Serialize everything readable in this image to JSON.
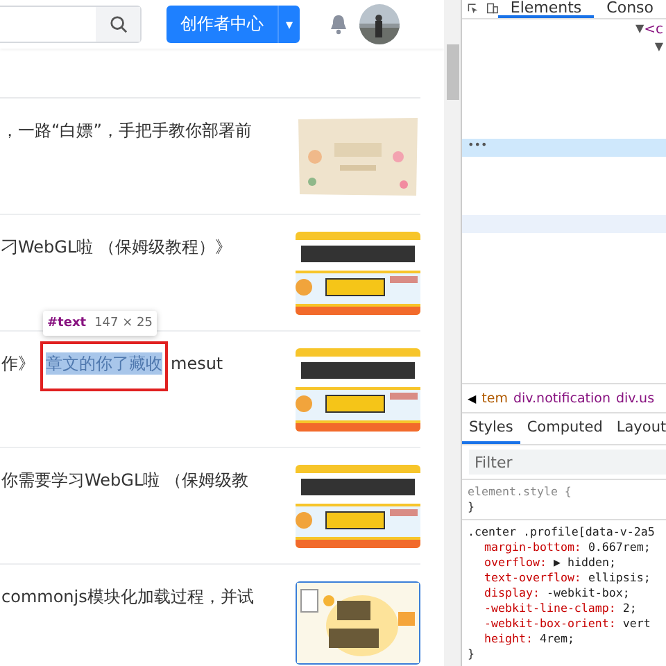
{
  "header": {
    "creator_button": "创作者中心",
    "creator_caret": "▾"
  },
  "articles": [
    {
      "title": "，一路“白嫖”，手把手教你部署前",
      "kind": "paper"
    },
    {
      "title": "刁WebGL啦 （保姆级教程）》",
      "kind": "banner"
    },
    {
      "title_before": "作》",
      "title_selected": "章文的你了藏收",
      "title_after": "mesut",
      "kind": "banner",
      "inspected": true
    },
    {
      "title": "你需要学习WebGL啦 （保姆级教",
      "kind": "banner"
    },
    {
      "title": "commonjs模块化加载过程，并试",
      "kind": "weekly"
    }
  ],
  "inspector_tooltip": {
    "node": "#text",
    "size": "147 × 25"
  },
  "devtools": {
    "tabs": [
      {
        "label": "Elements",
        "selected": true
      },
      {
        "label": "Conso",
        "selected": false
      }
    ],
    "tree": [
      {
        "text": "▼",
        "tag": "<c",
        "selected": false,
        "hovered": false
      },
      {
        "text": "▼",
        "selected": false,
        "hovered": false
      },
      {
        "text": "•••",
        "selected": true,
        "hovered": false
      },
      {
        "selected": false,
        "hovered": true
      }
    ],
    "breadcrumb": {
      "arrow": "◀",
      "items": [
        {
          "label": "tem",
          "kind": "item"
        },
        {
          "label": "div.notification",
          "kind": "class"
        },
        {
          "label": "div.us",
          "kind": "class"
        }
      ]
    },
    "style_tabs": [
      {
        "label": "Styles",
        "selected": true
      },
      {
        "label": "Computed",
        "selected": false
      },
      {
        "label": "Layout",
        "selected": false
      }
    ],
    "filter": {
      "placeholder": "Filter"
    },
    "rules": [
      {
        "selector": "element.style {",
        "close": "}"
      },
      {
        "selector": ".center .profile[data-v-2a5",
        "close": "}",
        "declarations": [
          {
            "property": "margin-bottom:",
            "value": "0.667rem;"
          },
          {
            "property": "overflow:",
            "toggle": "▶",
            "value": "hidden;"
          },
          {
            "property": "text-overflow:",
            "value": "ellipsis;"
          },
          {
            "property": "display:",
            "value": "-webkit-box;"
          },
          {
            "property": "-webkit-line-clamp:",
            "value": "2;"
          },
          {
            "property": "-webkit-box-orient:",
            "value": "vert"
          },
          {
            "property": "height:",
            "value": "4rem;"
          }
        ]
      }
    ]
  }
}
